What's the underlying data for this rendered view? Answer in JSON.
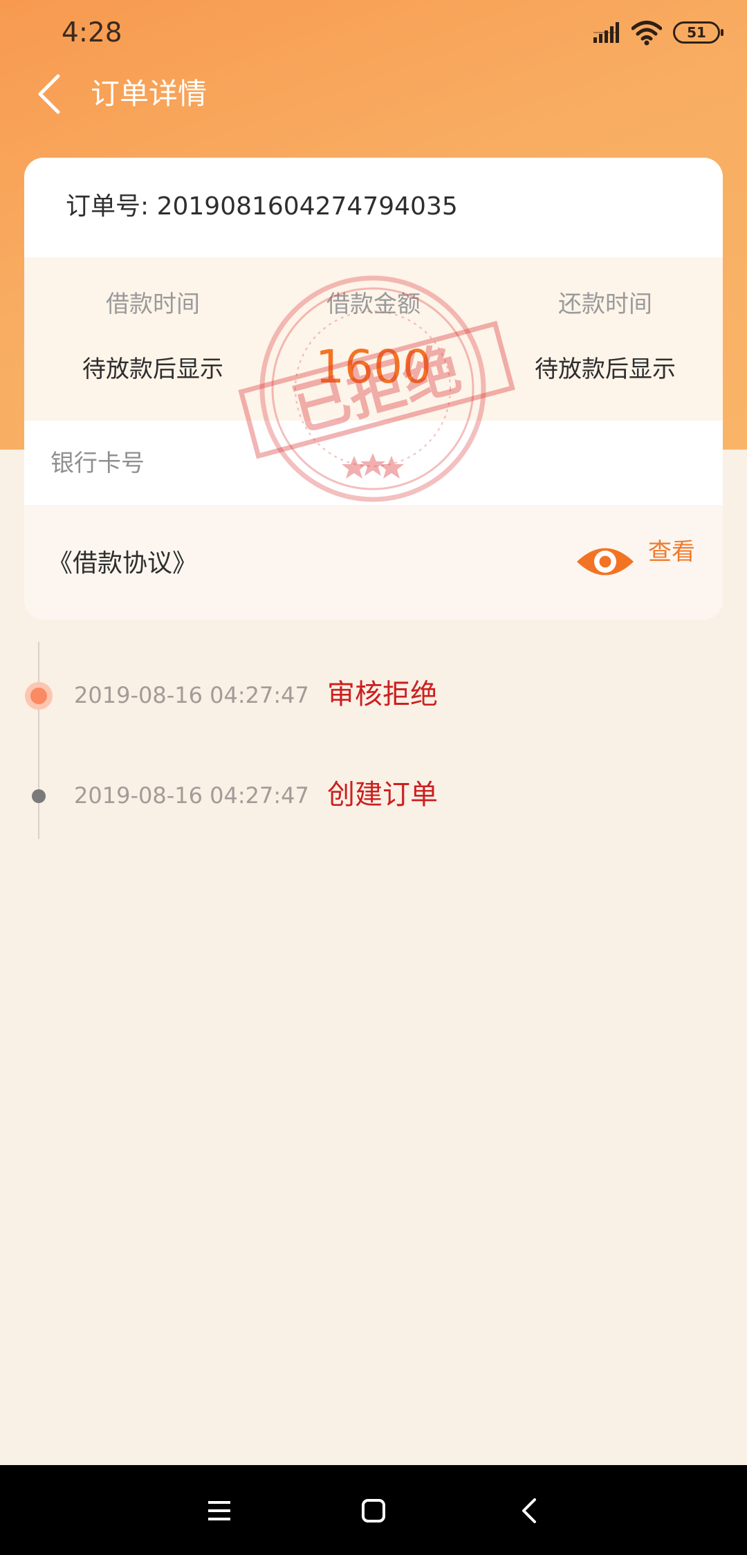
{
  "status_bar": {
    "time": "4:28",
    "battery": "51",
    "icons": [
      "signal-icon",
      "wifi-icon",
      "battery-icon"
    ]
  },
  "header": {
    "back_icon": "chevron-left-icon",
    "title": "订单详情"
  },
  "order": {
    "number_label": "订单号: 2019081604274794035",
    "loan_columns": [
      {
        "label": "借款时间",
        "value": "待放款后显示"
      },
      {
        "label": "借款金额",
        "value": "1600"
      },
      {
        "label": "还款时间",
        "value": "待放款后显示"
      }
    ],
    "bank_card_label": "银行卡号",
    "agreement_label": "《借款协议》",
    "view_label": "查看",
    "view_icon": "eye-icon",
    "stamp_text": "已拒绝"
  },
  "timeline": [
    {
      "time": "2019-08-16 04:27:47",
      "status": "审核拒绝",
      "active": true
    },
    {
      "time": "2019-08-16 04:27:47",
      "status": "创建订单",
      "active": false
    }
  ],
  "system_nav": {
    "buttons": [
      "menu-icon",
      "home-icon",
      "back-icon"
    ]
  },
  "colors": {
    "header_gradient_start": "#f79a50",
    "header_gradient_end": "#f9b468",
    "accent": "#f37324",
    "status_red": "#cc1f1f",
    "page_background": "#f9f0e6"
  }
}
